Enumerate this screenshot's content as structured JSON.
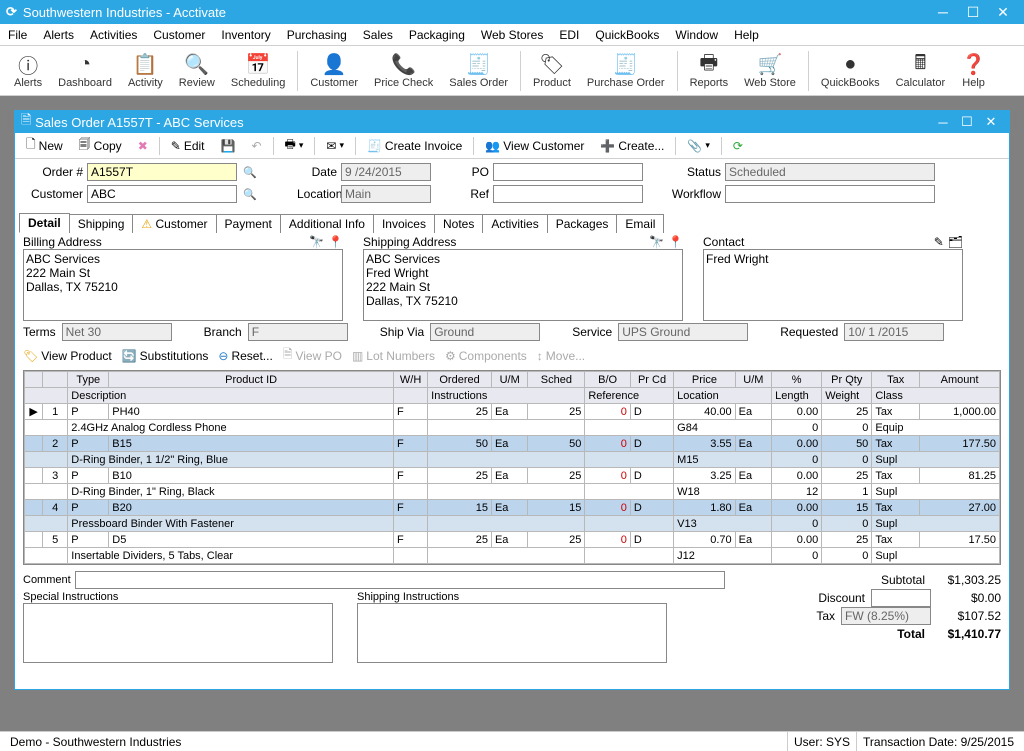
{
  "app": {
    "title": "Southwestern Industries - Acctivate"
  },
  "menu": [
    "File",
    "Alerts",
    "Activities",
    "Customer",
    "Inventory",
    "Purchasing",
    "Sales",
    "Packaging",
    "Web Stores",
    "EDI",
    "QuickBooks",
    "Window",
    "Help"
  ],
  "toolbar": [
    {
      "label": "Alerts"
    },
    {
      "label": "Dashboard"
    },
    {
      "label": "Activity"
    },
    {
      "label": "Review"
    },
    {
      "label": "Scheduling"
    },
    {
      "sep": true
    },
    {
      "label": "Customer"
    },
    {
      "label": "Price Check"
    },
    {
      "label": "Sales Order"
    },
    {
      "sep": true
    },
    {
      "label": "Product"
    },
    {
      "label": "Purchase Order"
    },
    {
      "sep": true
    },
    {
      "label": "Reports"
    },
    {
      "label": "Web Store"
    },
    {
      "sep": true
    },
    {
      "label": "QuickBooks"
    },
    {
      "label": "Calculator"
    },
    {
      "label": "Help"
    }
  ],
  "inner": {
    "title": "Sales Order A1557T - ABC Services",
    "tb": {
      "new": "New",
      "copy": "Copy",
      "edit": "Edit",
      "createInvoice": "Create Invoice",
      "viewCustomer": "View Customer",
      "createMenu": "Create..."
    },
    "form": {
      "orderNumLabel": "Order #",
      "orderNum": "A1557T",
      "customerLabel": "Customer",
      "customer": "ABC",
      "dateLabel": "Date",
      "date": "9 /24/2015",
      "locationLabel": "Location",
      "location": "Main",
      "poLabel": "PO",
      "po": "",
      "refLabel": "Ref",
      "ref": "",
      "statusLabel": "Status",
      "status": "Scheduled",
      "workflowLabel": "Workflow",
      "workflow": ""
    },
    "tabs": [
      "Detail",
      "Shipping",
      "Customer",
      "Payment",
      "Additional Info",
      "Invoices",
      "Notes",
      "Activities",
      "Packages",
      "Email"
    ],
    "billing": {
      "label": "Billing Address",
      "text": "ABC Services\n222 Main St\nDallas, TX 75210"
    },
    "shipping": {
      "label": "Shipping Address",
      "text": "ABC Services\nFred Wright\n222 Main St\nDallas, TX 75210"
    },
    "contact": {
      "label": "Contact",
      "text": "Fred Wright"
    },
    "terms": {
      "termsLabel": "Terms",
      "terms": "Net 30",
      "branchLabel": "Branch",
      "branch": "F",
      "shipViaLabel": "Ship Via",
      "shipVia": "Ground",
      "serviceLabel": "Service",
      "service": "UPS Ground",
      "requestedLabel": "Requested",
      "requested": "10/ 1 /2015"
    },
    "lineTb": {
      "viewProduct": "View Product",
      "subs": "Substitutions",
      "reset": "Reset...",
      "viewPO": "View PO",
      "lot": "Lot Numbers",
      "components": "Components",
      "move": "Move..."
    },
    "gridHdr1": [
      "",
      "",
      "Type",
      "Product ID",
      "W/H",
      "Ordered",
      "U/M",
      "Sched",
      "B/O",
      "Pr Cd",
      "Price",
      "U/M",
      "%",
      "Pr Qty",
      "Tax",
      "Amount"
    ],
    "gridHdr2": {
      "desc": "Description",
      "instr": "Instructions",
      "ref": "Reference",
      "loc": "Location",
      "len": "Length",
      "wt": "Weight",
      "class": "Class"
    },
    "lines": [
      {
        "n": "1",
        "type": "P",
        "pid": "PH40",
        "wh": "F",
        "ord": "25",
        "um": "Ea",
        "sched": "25",
        "bo": "0",
        "prcd": "D",
        "price": "40.00",
        "um2": "Ea",
        "pct": "0.00",
        "prqty": "25",
        "tax": "Tax",
        "amount": "1,000.00",
        "desc": "2.4GHz Analog Cordless Phone",
        "loc": "G84",
        "len": "0",
        "wt": "0",
        "class": "Equip"
      },
      {
        "n": "2",
        "type": "P",
        "pid": "B15",
        "wh": "F",
        "ord": "50",
        "um": "Ea",
        "sched": "50",
        "bo": "0",
        "prcd": "D",
        "price": "3.55",
        "um2": "Ea",
        "pct": "0.00",
        "prqty": "50",
        "tax": "Tax",
        "amount": "177.50",
        "desc": "D-Ring Binder, 1 1/2\" Ring, Blue",
        "loc": "M15",
        "len": "0",
        "wt": "0",
        "class": "Supl",
        "sel": true
      },
      {
        "n": "3",
        "type": "P",
        "pid": "B10",
        "wh": "F",
        "ord": "25",
        "um": "Ea",
        "sched": "25",
        "bo": "0",
        "prcd": "D",
        "price": "3.25",
        "um2": "Ea",
        "pct": "0.00",
        "prqty": "25",
        "tax": "Tax",
        "amount": "81.25",
        "desc": "D-Ring Binder, 1\" Ring, Black",
        "loc": "W18",
        "len": "12",
        "wt": "1",
        "class": "Supl"
      },
      {
        "n": "4",
        "type": "P",
        "pid": "B20",
        "wh": "F",
        "ord": "15",
        "um": "Ea",
        "sched": "15",
        "bo": "0",
        "prcd": "D",
        "price": "1.80",
        "um2": "Ea",
        "pct": "0.00",
        "prqty": "15",
        "tax": "Tax",
        "amount": "27.00",
        "desc": "Pressboard Binder With Fastener",
        "loc": "V13",
        "len": "0",
        "wt": "0",
        "class": "Supl",
        "sel": true
      },
      {
        "n": "5",
        "type": "P",
        "pid": "D5",
        "wh": "F",
        "ord": "25",
        "um": "Ea",
        "sched": "25",
        "bo": "0",
        "prcd": "D",
        "price": "0.70",
        "um2": "Ea",
        "pct": "0.00",
        "prqty": "25",
        "tax": "Tax",
        "amount": "17.50",
        "desc": "Insertable Dividers, 5 Tabs, Clear",
        "loc": "J12",
        "len": "0",
        "wt": "0",
        "class": "Supl"
      }
    ],
    "commentLabel": "Comment",
    "comment": "",
    "specialLabel": "Special Instructions",
    "shippingInstrLabel": "Shipping Instructions",
    "totals": {
      "subtotalLabel": "Subtotal",
      "subtotal": "$1,303.25",
      "discountLabel": "Discount",
      "discount": "",
      "discountVal": "$0.00",
      "taxLabel": "Tax",
      "taxCode": "FW (8.25%)",
      "taxVal": "$107.52",
      "totalLabel": "Total",
      "total": "$1,410.77"
    }
  },
  "status": {
    "left": "Demo - Southwestern Industries",
    "user": "User: SYS",
    "date": "Transaction Date: 9/25/2015"
  }
}
